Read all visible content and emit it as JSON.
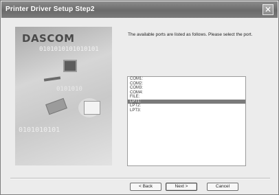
{
  "window": {
    "title": "Printer Driver Setup Step2",
    "close_glyph": "✕",
    "close_icon": "close-icon"
  },
  "art": {
    "brand": "DASCOM",
    "binary_1": "0101010101010101",
    "binary_2": "0101010",
    "binary_3": "0101010101",
    "graphic_icons": [
      "paper-roll-icon",
      "cable-icon",
      "printer-head-icon",
      "document-icon"
    ]
  },
  "content": {
    "instruction": "The available ports are listed as follows. Please select the port."
  },
  "ports": {
    "items": [
      "COM1:",
      "COM2:",
      "COM3:",
      "COM4:",
      "FILE:",
      "LPT1:",
      "LPT2:",
      "LPT3:"
    ],
    "selected_index": 5,
    "selected_color": "#7a7a7a"
  },
  "buttons": {
    "back": "< Back",
    "next": "Next >",
    "cancel": "Cancel"
  }
}
